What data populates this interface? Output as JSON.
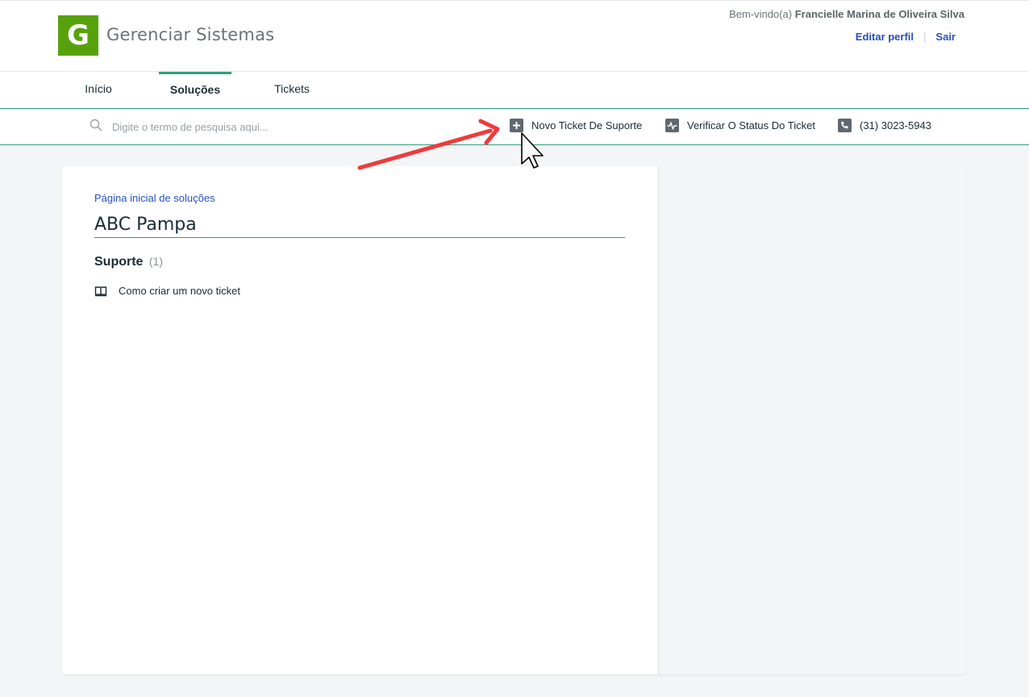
{
  "header": {
    "logo_letter": "G",
    "brand": "Gerenciar Sistemas",
    "welcome_prefix": "Bem-vindo(a)",
    "user_name": "Francielle Marina de Oliveira Silva",
    "edit_profile": "Editar perfil",
    "separator": "|",
    "logout": "Sair",
    "brand_color": "#57a20c"
  },
  "tabs": [
    {
      "label": "Início",
      "active": false
    },
    {
      "label": "Soluções",
      "active": true
    },
    {
      "label": "Tickets",
      "active": false
    }
  ],
  "toolbar": {
    "search_placeholder": "Digite o termo de pesquisa aqui...",
    "new_ticket": "Novo Ticket De Suporte",
    "check_status": "Verificar O Status Do Ticket",
    "phone": "(31) 3023-5943",
    "accent_color": "#2e9e79"
  },
  "main": {
    "breadcrumb": "Página inicial de soluções",
    "title": "ABC Pampa",
    "section": {
      "title": "Suporte",
      "count": "(1)",
      "articles": [
        "Como criar um novo ticket"
      ]
    }
  },
  "annotation": {
    "arrow_color": "#f03a3a",
    "cursor": "arrow-cursor-icon"
  }
}
